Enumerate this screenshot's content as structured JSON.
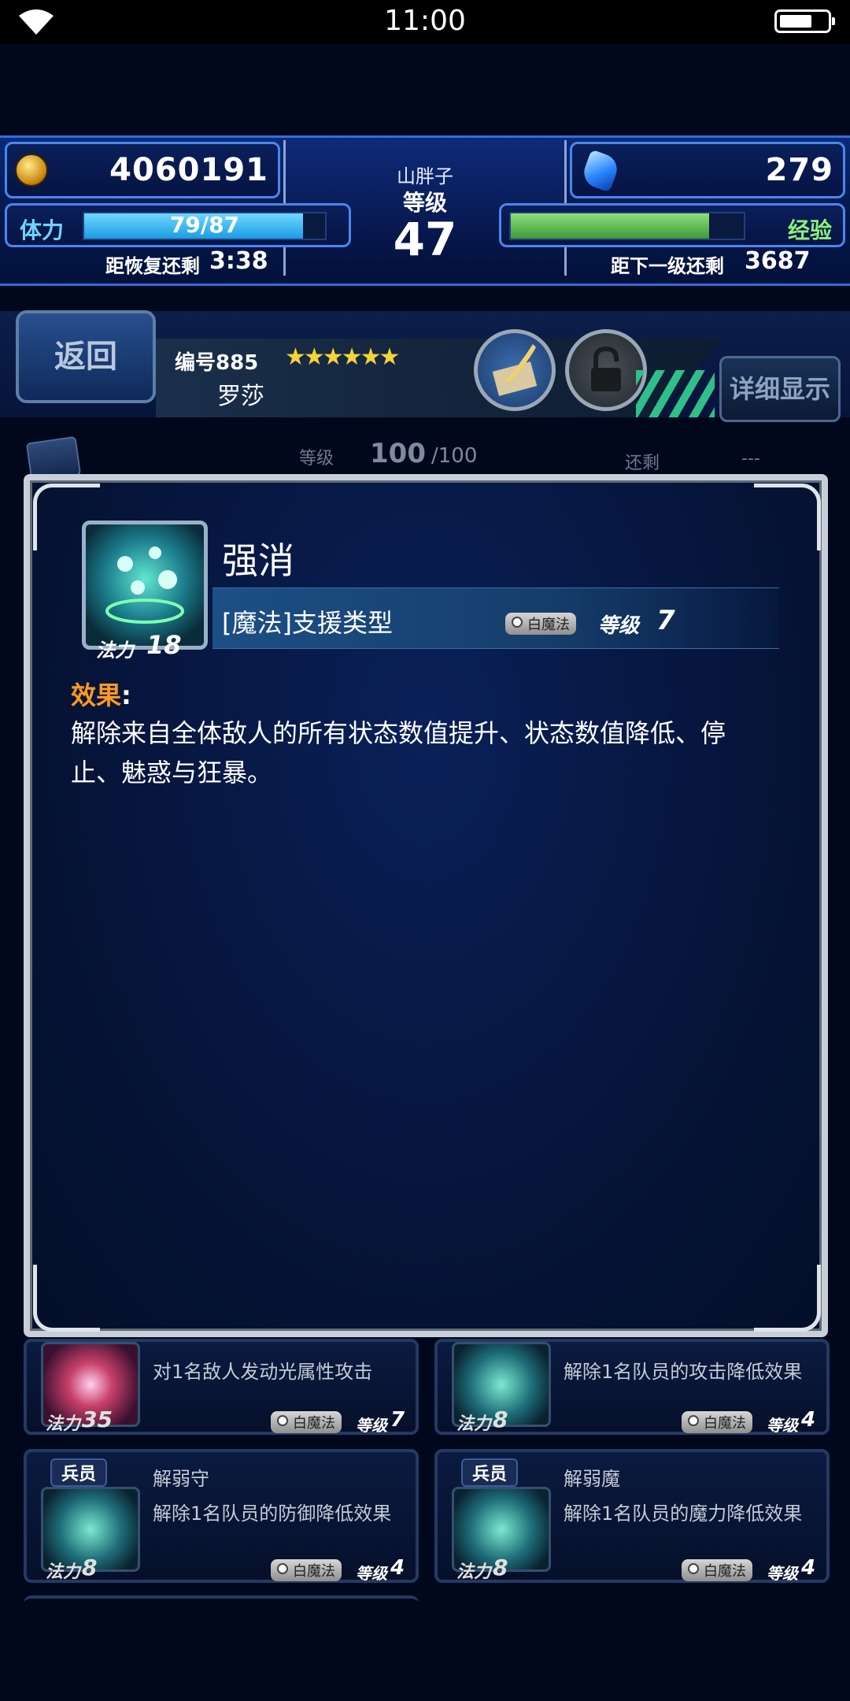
{
  "status_bar": {
    "time": "11:00"
  },
  "hud": {
    "gil": "4060191",
    "gems": "279",
    "player_name": "山胖子",
    "level_label": "等级",
    "level": "47",
    "stamina_label": "体力",
    "stamina": "79/87",
    "stamina_fraction": 0.908,
    "stamina_recover_label": "距恢复还剩",
    "stamina_recover_time": "3:38",
    "exp_label": "经验",
    "exp_fraction": 0.85,
    "next_level_label": "距下一级还剩",
    "next_level_value": "3687"
  },
  "unit": {
    "back_label": "返回",
    "number": "编号885",
    "stars": "★★★★★★",
    "name": "罗莎",
    "detail_label": "详细显示",
    "level_label": "等级",
    "level_current": "100",
    "level_max": "/100",
    "remaining_label": "还剩",
    "remaining_value": "---"
  },
  "modal": {
    "ability_name": "强消",
    "mp_label": "法力",
    "mp_cost": "18",
    "type": "[魔法]支援类型",
    "magic_school": "白魔法",
    "level_label": "等级",
    "level": "7",
    "effect_label": "效果",
    "effect_colon": ":",
    "effect_text": "解除来自全体敌人的所有状态数值提升、状态数值降低、停止、魅惑与狂暴。"
  },
  "cards": [
    {
      "desc": "对1名敌人发动光属性攻击",
      "mp_label": "法力",
      "mp": "35",
      "school": "白魔法",
      "level_label": "等级",
      "level": "7"
    },
    {
      "desc": "解除1名队员的攻击降低效果",
      "mp_label": "法力",
      "mp": "8",
      "school": "白魔法",
      "level_label": "等级",
      "level": "4"
    },
    {
      "tag": "兵员",
      "name": "解弱守",
      "desc": "解除1名队员的防御降低效果",
      "mp_label": "法力",
      "mp": "8",
      "school": "白魔法",
      "level_label": "等级",
      "level": "4"
    },
    {
      "tag": "兵员",
      "name": "解弱魔",
      "desc": "解除1名队员的魔力降低效果",
      "mp_label": "法力",
      "mp": "8",
      "school": "白魔法",
      "level_label": "等级",
      "level": "4"
    }
  ],
  "colors": {
    "accent_blue": "#4a86ee",
    "effect_orange": "#ff9a1f",
    "stamina_bar": "#2fb6f2",
    "exp_bar": "#54b84a"
  },
  "icons": [
    "wifi-icon",
    "battery-icon",
    "gil-coin-icon",
    "gem-icon",
    "quill-book-icon",
    "padlock-icon",
    "ability-icon"
  ]
}
